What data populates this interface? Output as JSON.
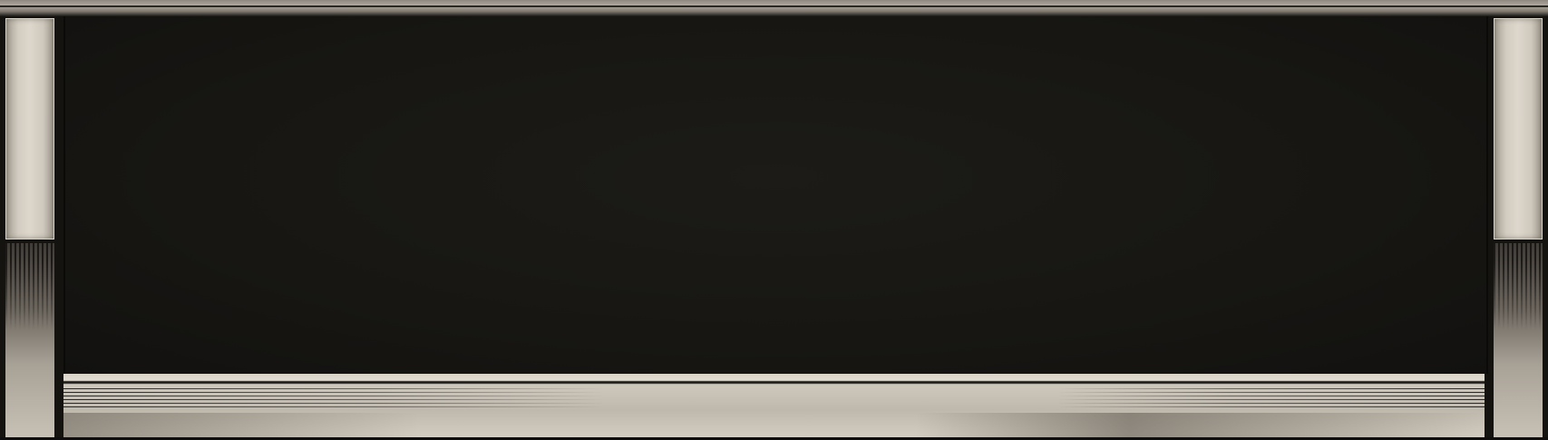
{
  "scene": {
    "description_colors": {
      "frame_dark": "#14130f",
      "panel_light": "#ddd7cc",
      "ledge_light": "#d8d2c7",
      "border_gray": "#b1aaa1"
    },
    "icons": []
  }
}
